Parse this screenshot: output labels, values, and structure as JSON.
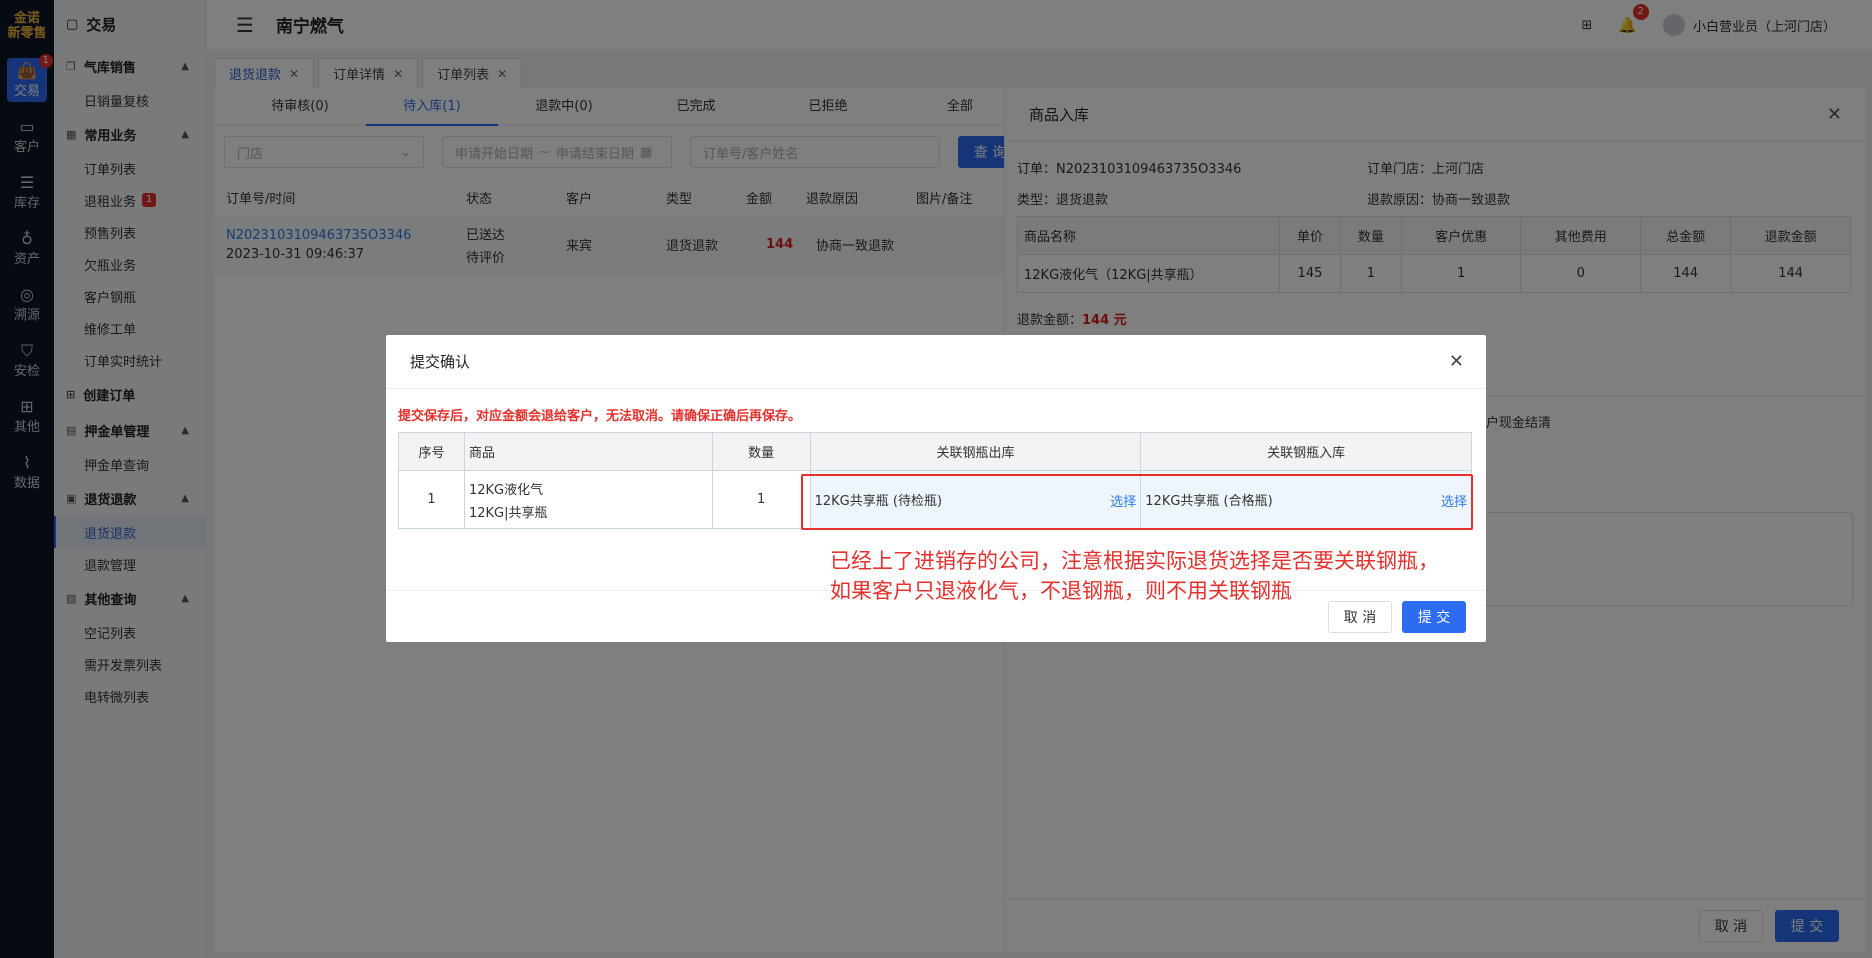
{
  "rail": {
    "logo_line1": "金诺",
    "logo_line2": "新零售",
    "items": [
      {
        "label": "交易",
        "icon": "bag-icon",
        "badge": "1"
      },
      {
        "label": "客户",
        "icon": "id-card-icon"
      },
      {
        "label": "库存",
        "icon": "list-icon"
      },
      {
        "label": "资产",
        "icon": "bulb-icon"
      },
      {
        "label": "溯源",
        "icon": "compass-icon"
      },
      {
        "label": "安检",
        "icon": "shield-icon"
      },
      {
        "label": "其他",
        "icon": "apps-icon"
      },
      {
        "label": "数据",
        "icon": "chart-icon"
      }
    ]
  },
  "menu": {
    "title": "交易",
    "g1": "气库销售",
    "g1_items": [
      "日销量复核"
    ],
    "g2": "常用业务",
    "g2_items": [
      "订单列表",
      "退租业务",
      "预售列表",
      "欠瓶业务",
      "客户钢瓶",
      "维修工单",
      "订单实时统计"
    ],
    "g2_badge": "1",
    "g3": "创建订单",
    "g4": "押金单管理",
    "g4_items": [
      "押金单查询"
    ],
    "g5": "退货退款",
    "g5_items": [
      "退货退款",
      "退款管理"
    ],
    "g6": "其他查询",
    "g6_items": [
      "空记列表",
      "需开发票列表",
      "电转微列表"
    ]
  },
  "topbar": {
    "title": "南宁燃气",
    "bell_count": "2",
    "user": "小白营业员（上河门店）"
  },
  "tabs": [
    "退货退款",
    "订单详情",
    "订单列表"
  ],
  "subtabs": [
    "待审核(0)",
    "待入库(1)",
    "退款中(0)",
    "已完成",
    "已拒绝",
    "全部"
  ],
  "filters": {
    "store": "门店",
    "date_start": "申请开始日期",
    "date_sep": "~",
    "date_end": "申请结束日期",
    "keyword": "订单号/客户姓名",
    "search": "查 询"
  },
  "list": {
    "headers": [
      "订单号/时间",
      "状态",
      "客户",
      "类型",
      "金额",
      "退款原因",
      "图片/备注"
    ],
    "row": {
      "order_no": "N2023103109463735O3346",
      "time": "2023-10-31 09:46:37",
      "status1": "已送达",
      "status2": "待评价",
      "customer": "来宾",
      "type": "退货退款",
      "amount": "144",
      "reason": "协商一致退款"
    }
  },
  "drawer": {
    "title": "商品入库",
    "order_label": "订单：",
    "order_no": "N2023103109463735O3346",
    "store_label": "订单门店：",
    "store": "上河门店",
    "type_label": "类型：",
    "type": "退货退款",
    "reason_label": "退款原因：",
    "reason": "协商一致退款",
    "headers": [
      "商品名称",
      "单价",
      "数量",
      "客户优惠",
      "其他费用",
      "总金额",
      "退款金额"
    ],
    "row": [
      "12KG液化气（12KG|共享瓶）",
      "145",
      "1",
      "1",
      "0",
      "144",
      "144"
    ],
    "refund_label": "退款金额：",
    "refund_amount": "144 元",
    "settle_text": "客户现金结清",
    "cancel": "取 消",
    "submit": "提 交"
  },
  "modal": {
    "title": "提交确认",
    "warning": "提交保存后，对应金额会退给客户，无法取消。请确保正确后再保存。",
    "headers": [
      "序号",
      "商品",
      "数量",
      "关联钢瓶出库",
      "关联钢瓶入库"
    ],
    "row": {
      "index": "1",
      "product1": "12KG液化气",
      "product2": "12KG|共享瓶",
      "qty": "1",
      "out": "12KG共享瓶 (待检瓶)",
      "in": "12KG共享瓶 (合格瓶)",
      "pick": "选择"
    },
    "annotation1": "已经上了进销存的公司，注意根据实际退货选择是否要关联钢瓶，",
    "annotation2": "如果客户只退液化气，不退钢瓶，则不用关联钢瓶",
    "cancel": "取 消",
    "submit": "提 交"
  }
}
